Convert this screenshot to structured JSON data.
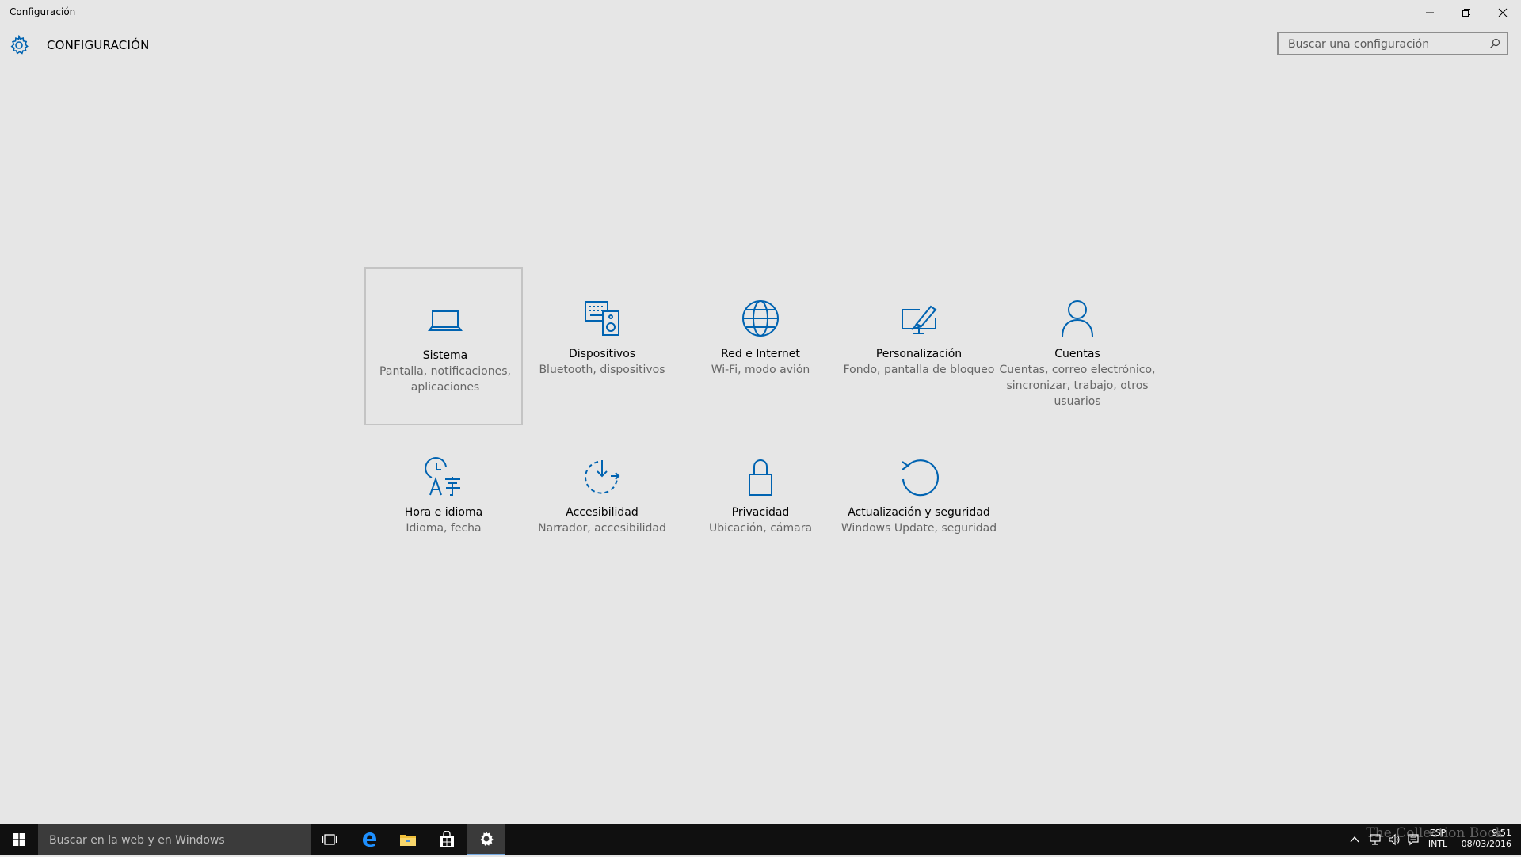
{
  "window": {
    "title": "Configuración"
  },
  "header": {
    "heading": "CONFIGURACIÓN",
    "search_placeholder": "Buscar una configuración"
  },
  "accent_color": "#0063b1",
  "tiles": [
    {
      "name": "Sistema",
      "desc": "Pantalla, notificaciones, aplicaciones",
      "icon": "laptop-icon",
      "selected": true
    },
    {
      "name": "Dispositivos",
      "desc": "Bluetooth, dispositivos",
      "icon": "devices-icon"
    },
    {
      "name": "Red e Internet",
      "desc": "Wi-Fi, modo avión",
      "icon": "globe-icon"
    },
    {
      "name": "Personalización",
      "desc": "Fondo, pantalla de bloqueo",
      "icon": "personalization-icon"
    },
    {
      "name": "Cuentas",
      "desc": "Cuentas, correo electrónico, sincronizar, trabajo, otros usuarios",
      "icon": "person-icon"
    },
    {
      "name": "Hora e idioma",
      "desc": "Idioma, fecha",
      "icon": "time-language-icon"
    },
    {
      "name": "Accesibilidad",
      "desc": "Narrador, accesibilidad",
      "icon": "accessibility-icon"
    },
    {
      "name": "Privacidad",
      "desc": "Ubicación, cámara",
      "icon": "lock-icon"
    },
    {
      "name": "Actualización y seguridad",
      "desc": "Windows Update, seguridad",
      "icon": "update-icon"
    }
  ],
  "taskbar": {
    "search_placeholder": "Buscar en la web y en Windows",
    "lang_top": "ESP",
    "lang_bottom": "INTL",
    "time": "9:51",
    "date": "08/03/2016"
  },
  "watermark": "The Collection Book"
}
